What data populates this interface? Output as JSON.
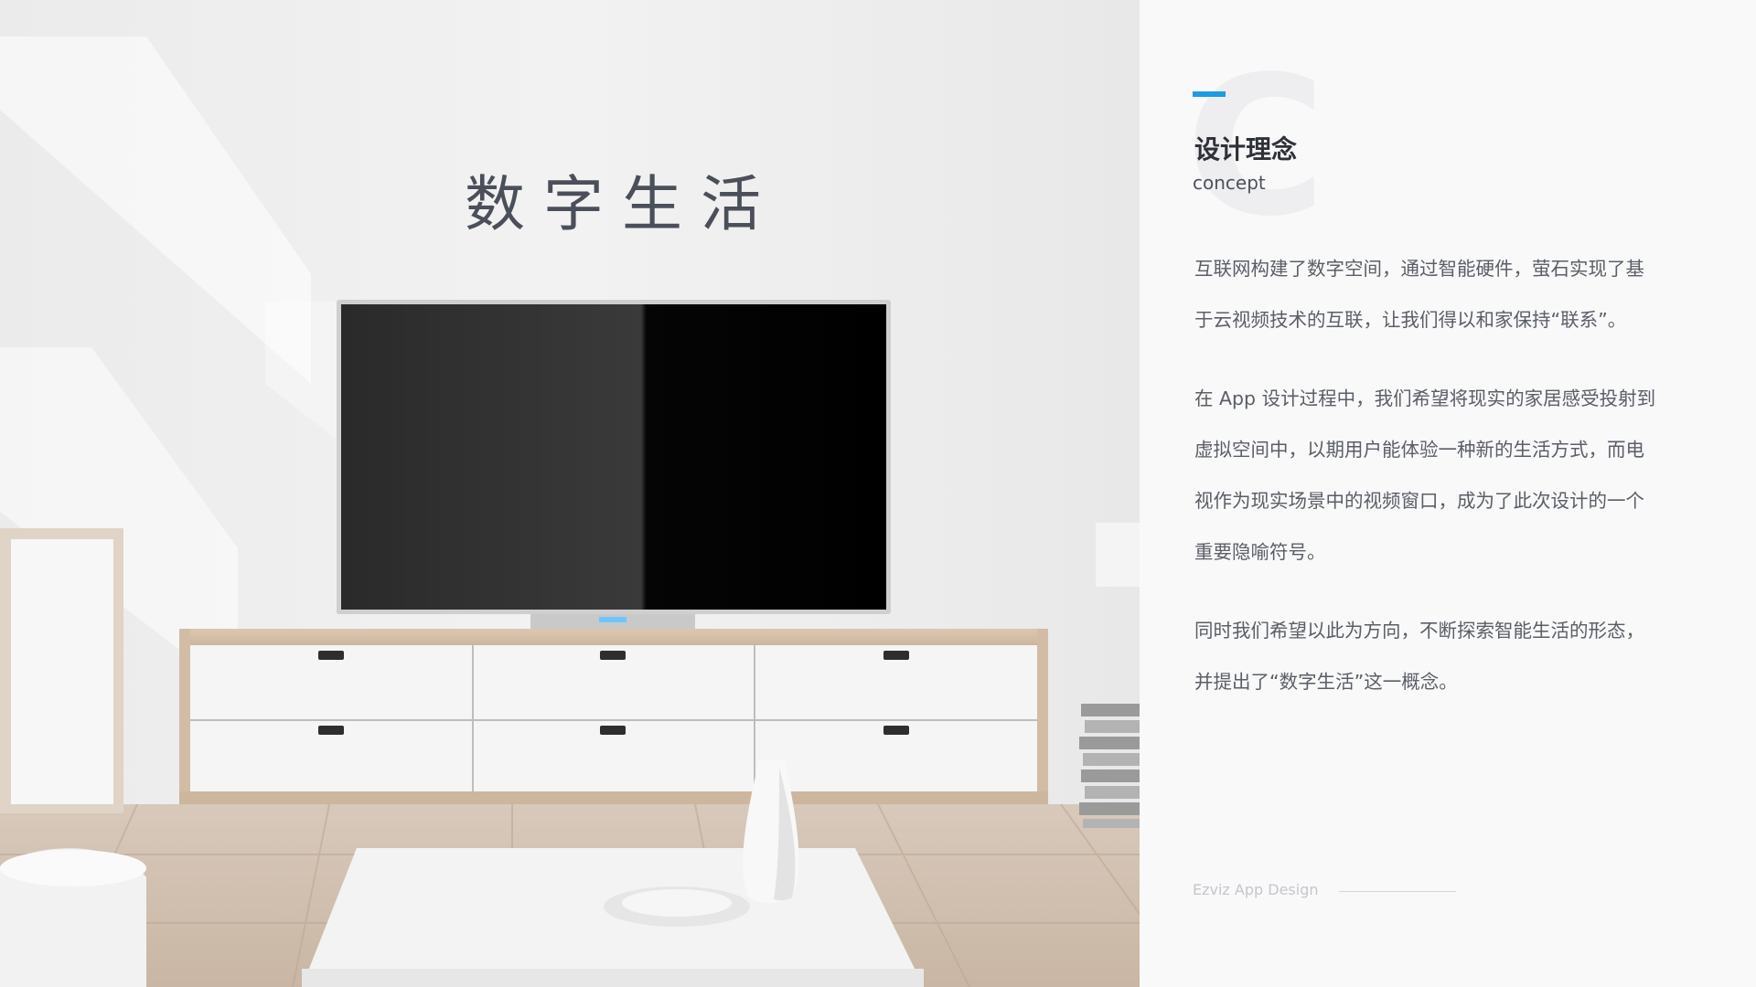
{
  "scene": {
    "title": "数字生活"
  },
  "panel": {
    "accent_color": "#1e9be2",
    "big_letter": "C",
    "heading": "设计理念",
    "subheading": "concept",
    "paragraphs": [
      [
        "互联网构建了数字空间，通过智能硬件，萤石实现了基",
        "于云视频技术的互联，让我们得以和家保持“联系”。"
      ],
      [
        "在 App 设计过程中，我们希望将现实的家居感受投射到",
        "虚拟空间中，以期用户能体验一种新的生活方式，而电",
        "视作为现实场景中的视频窗口，成为了此次设计的一个",
        "重要隐喻符号。"
      ],
      [
        "同时我们希望以此为方向，不断探索智能生活的形态，",
        "并提出了“数字生活”这一概念。"
      ]
    ],
    "footer": "Ezviz App Design"
  }
}
